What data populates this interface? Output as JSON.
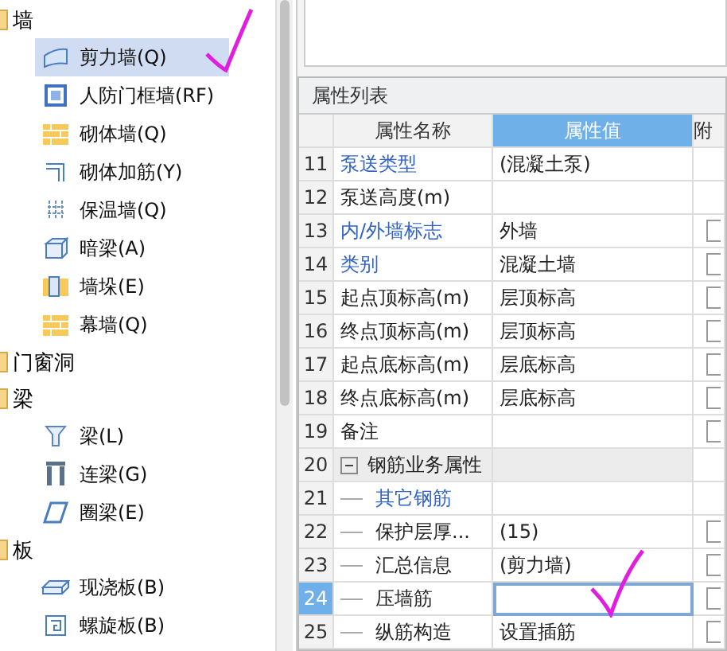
{
  "tree": [
    {
      "label": "墙",
      "children": [
        {
          "label": "剪力墙(Q)",
          "kind": "shear",
          "selected": true
        },
        {
          "label": "人防门框墙(RF)",
          "kind": "frame",
          "selected": false
        },
        {
          "label": "砌体墙(Q)",
          "kind": "brick",
          "selected": false
        },
        {
          "label": "砌体加筋(Y)",
          "kind": "rebar",
          "selected": false
        },
        {
          "label": "保温墙(Q)",
          "kind": "insul",
          "selected": false
        },
        {
          "label": "暗梁(A)",
          "kind": "hidden",
          "selected": false
        },
        {
          "label": "墙垛(E)",
          "kind": "pier",
          "selected": false
        },
        {
          "label": "幕墙(Q)",
          "kind": "brick",
          "selected": false
        }
      ]
    },
    {
      "label": "门窗洞"
    },
    {
      "label": "梁",
      "children": [
        {
          "label": "梁(L)",
          "kind": "beam",
          "selected": false
        },
        {
          "label": "连梁(G)",
          "kind": "link",
          "selected": false
        },
        {
          "label": "圈梁(E)",
          "kind": "ring",
          "selected": false
        }
      ]
    },
    {
      "label": "板",
      "children": [
        {
          "label": "现浇板(B)",
          "kind": "slab",
          "selected": false
        },
        {
          "label": "螺旋板(B)",
          "kind": "spiral",
          "selected": false
        }
      ]
    }
  ],
  "properties": {
    "title": "属性列表",
    "columns": [
      "属性名称",
      "属性值",
      "附"
    ],
    "rows": [
      {
        "no": "11",
        "name": "泵送类型",
        "value": "(混凝土泵)",
        "kind": "public",
        "checkbox": false,
        "selected": false
      },
      {
        "no": "12",
        "name": "泵送高度(m)",
        "kind": "private",
        "checkbox": false,
        "selected": false
      },
      {
        "no": "13",
        "name": "内/外墙标志",
        "value": "外墙",
        "kind": "public",
        "checkbox": true,
        "selected": false
      },
      {
        "no": "14",
        "name": "类别",
        "value": "混凝土墙",
        "kind": "public",
        "checkbox": true,
        "selected": false
      },
      {
        "no": "15",
        "name": "起点顶标高(m)",
        "value": "层顶标高",
        "kind": "private",
        "checkbox": true,
        "selected": false
      },
      {
        "no": "16",
        "name": "终点顶标高(m)",
        "value": "层顶标高",
        "kind": "private",
        "checkbox": true,
        "selected": false
      },
      {
        "no": "17",
        "name": "起点底标高(m)",
        "value": "层底标高",
        "kind": "private",
        "checkbox": true,
        "selected": false
      },
      {
        "no": "18",
        "name": "终点底标高(m)",
        "value": "层底标高",
        "kind": "private",
        "checkbox": true,
        "selected": false
      },
      {
        "no": "19",
        "name": "备注",
        "kind": "private",
        "checkbox": true,
        "selected": false
      },
      {
        "no": "20",
        "name": "钢筋业务属性",
        "kind": "group",
        "expanded": true,
        "checkbox": false,
        "selected": false,
        "children": [
          {
            "no": "21",
            "name": "其它钢筋",
            "kind": "public",
            "checkbox": false,
            "selected": false
          },
          {
            "no": "22",
            "name": "保护层厚...",
            "value": "(15)",
            "kind": "private",
            "checkbox": true,
            "selected": false
          },
          {
            "no": "23",
            "name": "汇总信息",
            "value": "(剪力墙)",
            "kind": "private",
            "checkbox": true,
            "selected": false
          },
          {
            "no": "24",
            "name": "压墙筋",
            "kind": "private",
            "checkbox": true,
            "selected": true
          },
          {
            "no": "25",
            "name": "纵筋构造",
            "value": "设置插筋",
            "kind": "private",
            "checkbox": true,
            "selected": false
          }
        ]
      }
    ]
  }
}
